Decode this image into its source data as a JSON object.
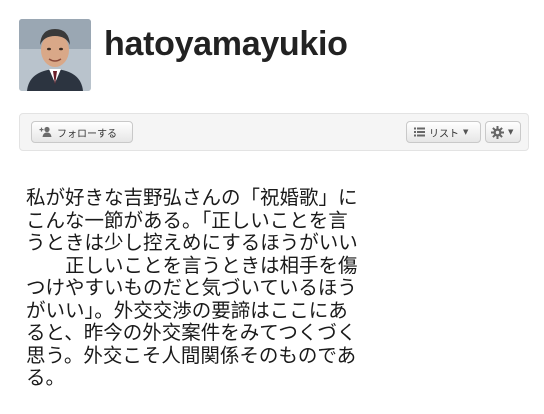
{
  "profile": {
    "username": "hatoyamayukio"
  },
  "actions": {
    "follow_label": "フォローする",
    "list_label": "リスト"
  },
  "tweet": {
    "lines": [
      "私が好きな吉野弘さんの「祝婚歌」に",
      "こんな一節がある。「正しいことを言",
      "うときは少し控えめにするほうがいい",
      "　　正しいことを言うときは相手を傷",
      "つけやすいものだと気づいているほう",
      "がいい」。外交交渉の要諦はここにあ",
      "ると、昨今の外交案件をみてつくづく",
      "思う。外交こそ人間関係そのものであ",
      "る。"
    ]
  },
  "icons": {
    "follow": "add-user-icon",
    "list": "list-icon",
    "settings": "gear-icon",
    "dropdown": "caret-down-icon"
  }
}
